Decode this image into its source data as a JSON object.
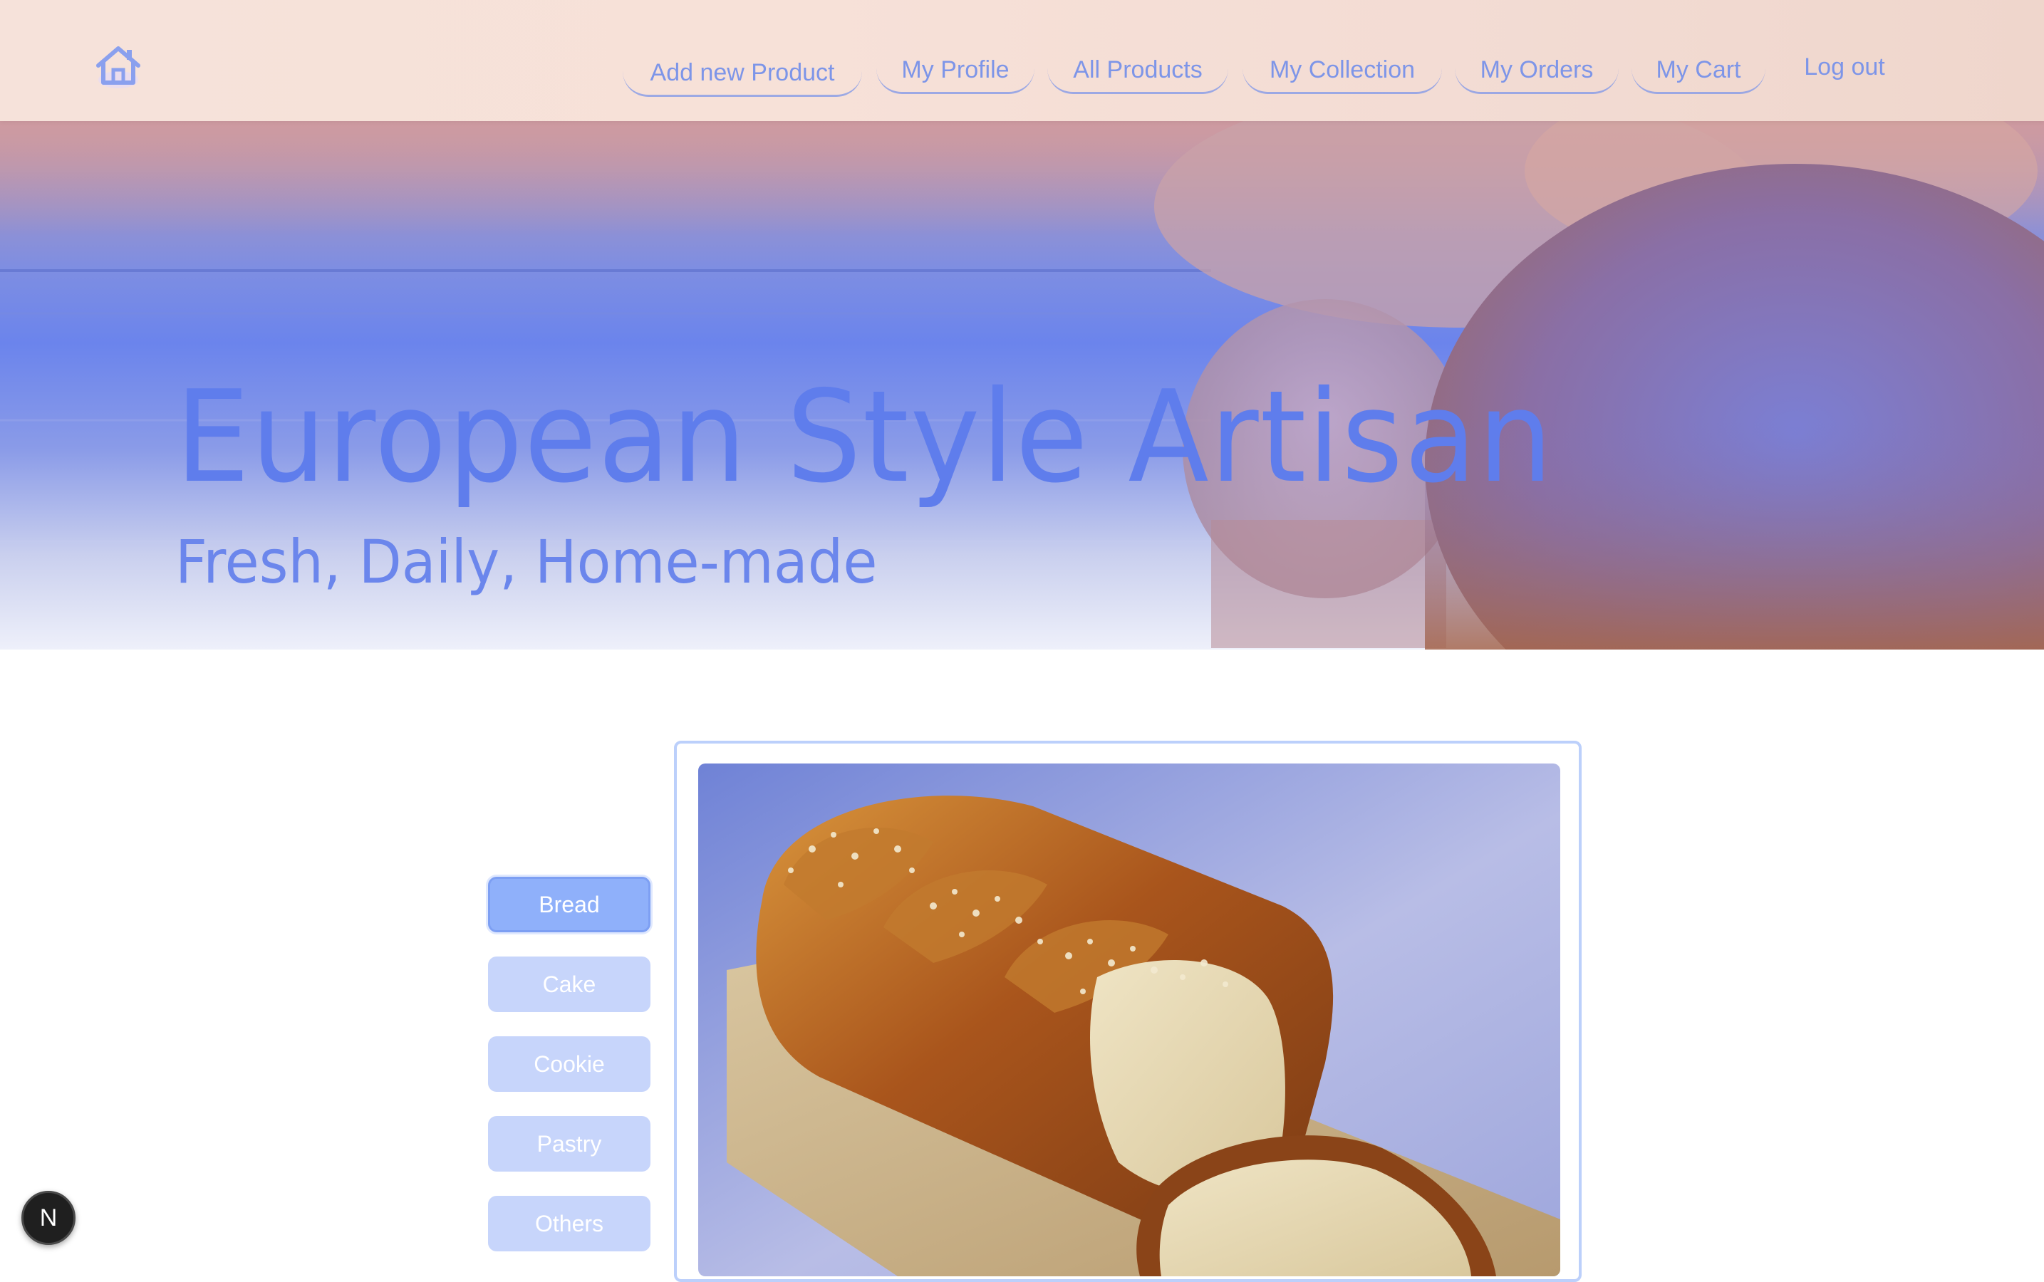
{
  "nav": {
    "home_icon": "home-icon",
    "links": [
      {
        "label": "Add new Product"
      },
      {
        "label": "My Profile"
      },
      {
        "label": "All Products"
      },
      {
        "label": "My Collection"
      },
      {
        "label": "My Orders"
      },
      {
        "label": "My Cart"
      },
      {
        "label": "Log out"
      }
    ]
  },
  "hero": {
    "title": "European Style Artisan",
    "subtitle": "Fresh, Daily, Home-made"
  },
  "categories": {
    "selected": "Bread",
    "items": [
      {
        "label": "Bread"
      },
      {
        "label": "Cake"
      },
      {
        "label": "Cookie"
      },
      {
        "label": "Pastry"
      },
      {
        "label": "Others"
      }
    ]
  },
  "product": {
    "image_icon": "bread-loaf-photo"
  },
  "dev_badge": {
    "letter": "N"
  },
  "colors": {
    "accent": "#7d95e8",
    "hero_text": "#5f7dec",
    "category_active": "#8fb0fa",
    "category_inactive": "#c7d5fb",
    "card_border": "#bcd0fb"
  }
}
